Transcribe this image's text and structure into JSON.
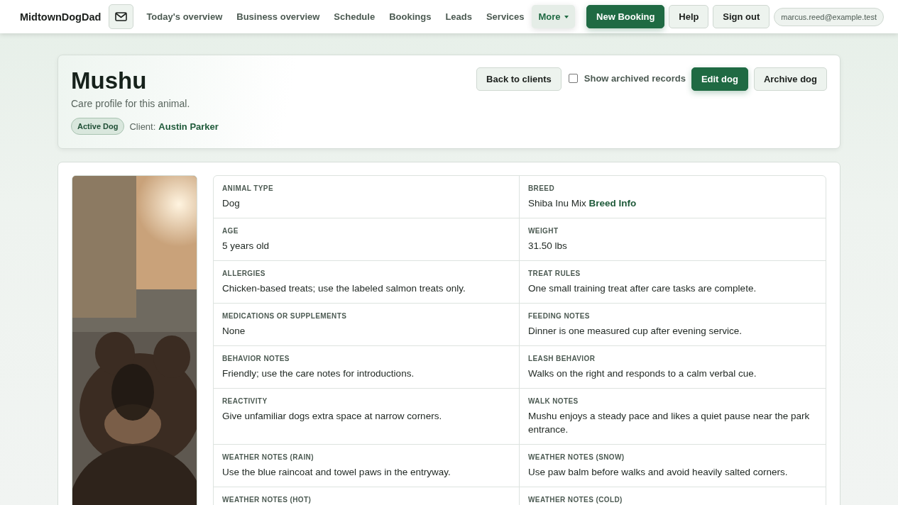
{
  "brand": "MidtownDogDad",
  "nav": [
    {
      "label": "Today's overview",
      "selected": false
    },
    {
      "label": "Business overview",
      "selected": false
    },
    {
      "label": "Schedule",
      "selected": false
    },
    {
      "label": "Bookings",
      "selected": false
    },
    {
      "label": "Leads",
      "selected": false
    },
    {
      "label": "Services",
      "selected": false
    },
    {
      "label": "More",
      "selected": true,
      "kind": "dropdown"
    }
  ],
  "actions": {
    "primary": "New Booking",
    "help": "Help",
    "sign_out": "Sign out",
    "account": "marcus.reed@example.test"
  },
  "profile": {
    "name": "Mushu",
    "subtitle": "Care profile for this animal.",
    "status": "Active Dog",
    "client_label": "Client:",
    "client": "Austin Parker",
    "back": "Back to clients",
    "show_archived": {
      "label": "Show archived records",
      "checked": false
    },
    "edit": "Edit dog",
    "archive": "Archive dog"
  },
  "details": [
    {
      "label": "ANIMAL TYPE",
      "value": "Dog"
    },
    {
      "label": "BREED",
      "value": "Shiba Inu Mix",
      "link": "Breed Info"
    },
    {
      "label": "AGE",
      "value": "5 years old"
    },
    {
      "label": "WEIGHT",
      "value": "31.50 lbs"
    },
    {
      "label": "ALLERGIES",
      "value": "Chicken-based treats; use the labeled salmon treats only."
    },
    {
      "label": "TREAT RULES",
      "value": "One small training treat after care tasks are complete."
    },
    {
      "label": "MEDICATIONS OR SUPPLEMENTS",
      "value": "None"
    },
    {
      "label": "FEEDING NOTES",
      "value": "Dinner is one measured cup after evening service."
    },
    {
      "label": "BEHAVIOR NOTES",
      "value": "Friendly; use the care notes for introductions."
    },
    {
      "label": "LEASH BEHAVIOR",
      "value": "Walks on the right and responds to a calm verbal cue."
    },
    {
      "label": "REACTIVITY",
      "value": "Give unfamiliar dogs extra space at narrow corners."
    },
    {
      "label": "WALK NOTES",
      "value": "Mushu enjoys a steady pace and likes a quiet pause near the park entrance."
    },
    {
      "label": "WEATHER NOTES (RAIN)",
      "value": "Use the blue raincoat and towel paws in the entryway."
    },
    {
      "label": "WEATHER NOTES (SNOW)",
      "value": "Use paw balm before walks and avoid heavily salted corners."
    },
    {
      "label": "WEATHER NOTES (HOT)"
    },
    {
      "label": "WEATHER NOTES (COLD)"
    }
  ]
}
